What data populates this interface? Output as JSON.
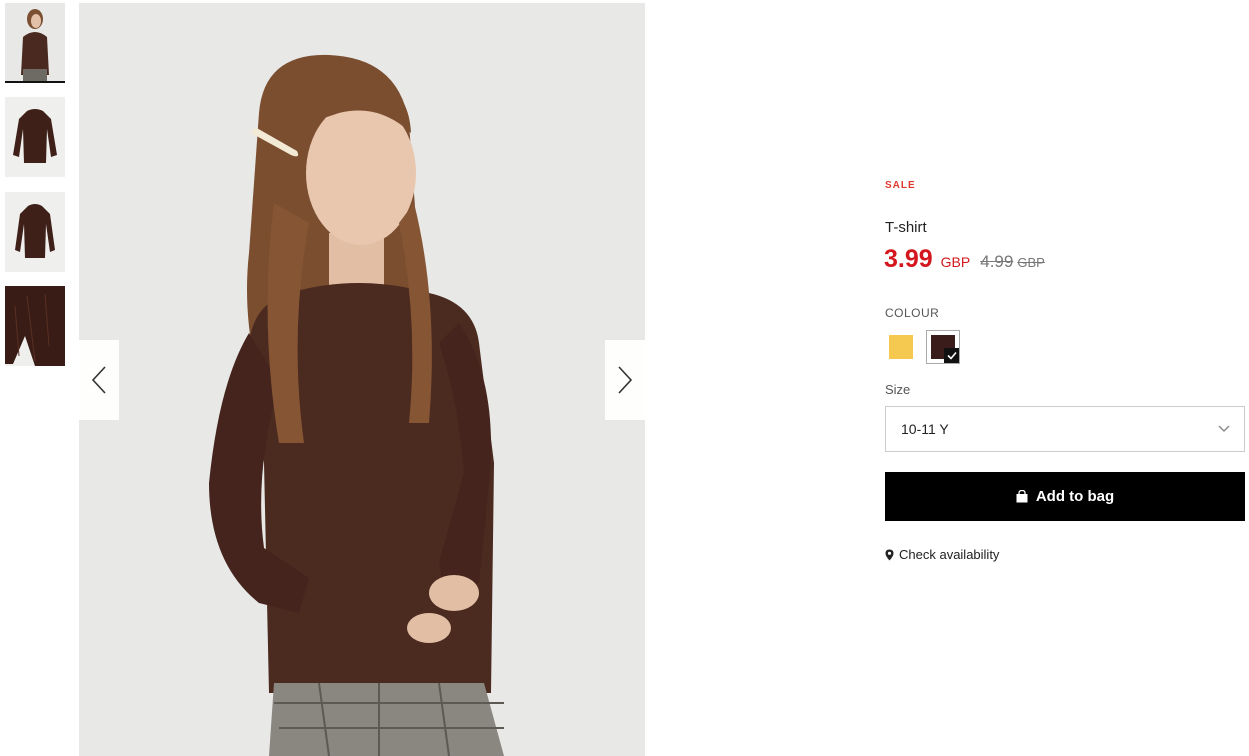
{
  "gallery": {
    "thumbnails": [
      {
        "label": "model-front"
      },
      {
        "label": "garment-flat"
      },
      {
        "label": "garment-flat-alt"
      },
      {
        "label": "garment-detail"
      }
    ],
    "active_index": 0,
    "prev_icon": "chevron-left-icon",
    "next_icon": "chevron-right-icon"
  },
  "product": {
    "badge": "SALE",
    "name": "T-shirt",
    "price": {
      "current": "3.99",
      "current_currency": "GBP",
      "original": "4.99",
      "original_currency": "GBP"
    },
    "colour_label": "COLOUR",
    "colours": [
      {
        "name": "yellow",
        "hex": "#f5c94f",
        "selected": false
      },
      {
        "name": "brown",
        "hex": "#3a1c1a",
        "selected": true
      }
    ],
    "size_label": "Size",
    "size_value": "10-11 Y",
    "add_button": "Add to bag",
    "check_availability": "Check availability"
  },
  "colors": {
    "sale_red": "#d4161d",
    "badge_red": "#e03a2f",
    "button_black": "#000000"
  }
}
